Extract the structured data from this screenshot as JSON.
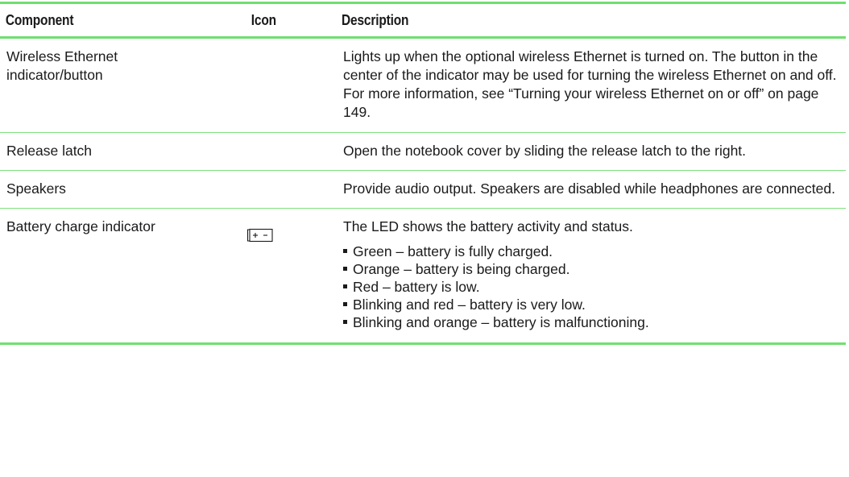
{
  "table": {
    "headers": {
      "component": "Component",
      "icon": "Icon",
      "description": "Description"
    },
    "rows": [
      {
        "component": "Wireless Ethernet indicator/button",
        "description": "Lights up when the optional wireless Ethernet is turned on. The button in the center of the indicator may be used for turning the wireless Ethernet on and off. For more information, see “Turning your wireless Ethernet on or off” on page 149."
      },
      {
        "component": "Release latch",
        "description": "Open the notebook cover by sliding the release latch to the right."
      },
      {
        "component": "Speakers",
        "description": "Provide audio output. Speakers are disabled while headphones are connected."
      },
      {
        "component": "Battery charge indicator",
        "icon": "battery-icon",
        "description": "The LED shows the battery activity and status.",
        "bullets": [
          "Green – battery is fully charged.",
          "Orange – battery is being charged.",
          "Red – battery is low.",
          "Blinking and red – battery is very low.",
          "Blinking and orange – battery is malfunctioning."
        ]
      }
    ]
  },
  "colors": {
    "rule": "#6ee06e",
    "text": "#1a1a1a"
  }
}
